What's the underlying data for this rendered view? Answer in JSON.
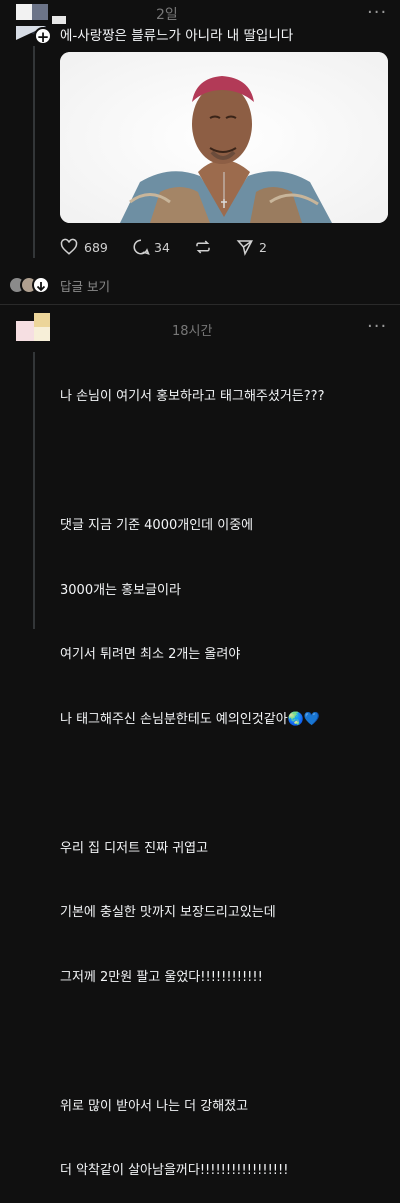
{
  "post1": {
    "time": "2일",
    "text": "에-사랑짱은 블류느가 아니라 내 딸입니다",
    "follow_icon": "plus",
    "stats": {
      "likes": "689",
      "comments": "34",
      "shares": "2"
    }
  },
  "replies": {
    "label": "답글 보기"
  },
  "post2": {
    "time": "18시간",
    "lines": [
      "나 손님이 여기서 홍보하라고 태그해주셨거든???",
      "",
      "댓글 지금 기준 4000개인데 이중에",
      "3000개는 홍보글이라",
      "여기서 튀려면 최소 2개는 올려야",
      "나 태그해주신 손님분한테도 예의인것같아🌏💙",
      "",
      "우리 집 디저트 진짜 귀엽고",
      "기본에 충실한 맛까지 보장드리고있는데",
      "그저께 2만원 팔고 울었다!!!!!!!!!!!!",
      "",
      "위로 많이 받아서 나는 더 강해졌고",
      "더 악착같이 살아남을꺼다!!!!!!!!!!!!!!!!!"
    ]
  },
  "colors": {
    "background": "#101010",
    "text": "#f3f5f7",
    "muted": "#777777"
  }
}
